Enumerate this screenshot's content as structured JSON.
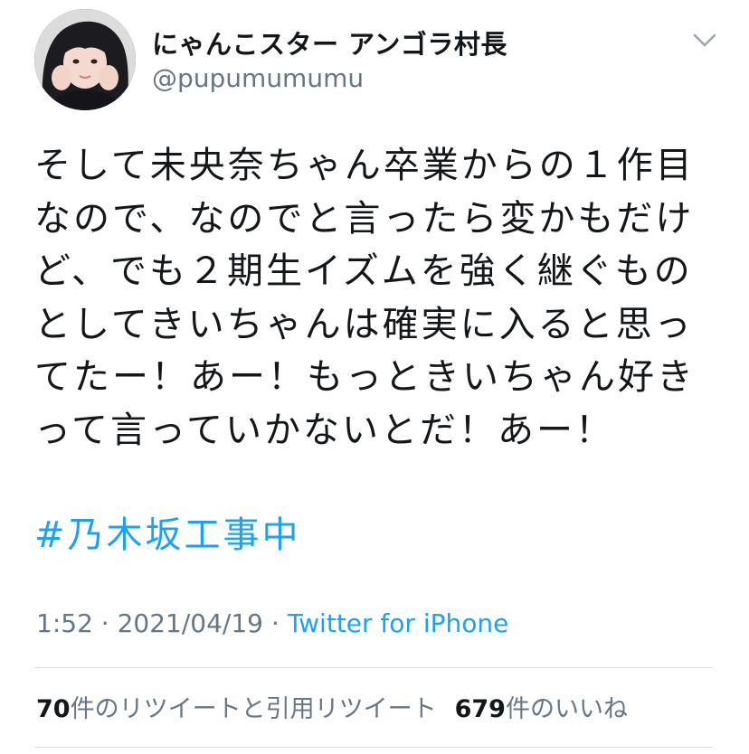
{
  "author": {
    "name": "にゃんこスター アンゴラ村長",
    "handle": "@pupumumumu"
  },
  "tweet": {
    "lines": [
      "そして未央奈ちゃん卒業からの１作目",
      "なので、なのでと言ったら変かもだけ",
      "ど、でも２期生イズムを強く継ぐもの",
      "としてきいちゃんは確実に入ると思っ",
      "てたー！あー！もっときいちゃん好き",
      "って言っていかないとだ！あー！"
    ],
    "hashtag": "#乃木坂工事中"
  },
  "meta": {
    "time": "1:52",
    "separator1": " · ",
    "date": "2021/04/19",
    "separator2": " · ",
    "source": "Twitter for iPhone"
  },
  "stats": {
    "retweets_count": "70",
    "retweets_label": "件のリツイートと引用リツイート",
    "likes_count": "679",
    "likes_label": "件のいいね"
  },
  "icons": {
    "menu": "chevron-down-icon",
    "avatar": "profile-photo"
  },
  "colors": {
    "link": "#1da1f2",
    "secondary_text": "#657786",
    "primary_text": "#14171a",
    "divider": "#d8dde1"
  }
}
